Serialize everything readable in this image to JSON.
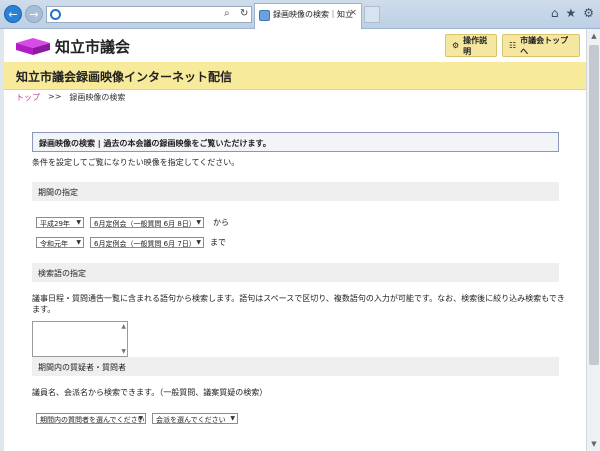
{
  "browser": {
    "tab_title": "録画映像の検索｜知立市議...",
    "tab_close": "×",
    "back_glyph": "←",
    "forward_glyph": "→",
    "address_icons": [
      "search-icon",
      "refresh-icon"
    ],
    "toolbar_icons": [
      "home-icon",
      "star-icon",
      "gear-icon"
    ]
  },
  "header": {
    "site_name": "知立市議会",
    "guide_button": "操作説明",
    "top_button": "市議会トップへ",
    "logo_color": "#c02ad0"
  },
  "banner": {
    "title": "知立市議会録画映像インターネット配信",
    "color": "#f7ea9a"
  },
  "breadcrumb": {
    "home": "トップ",
    "separator": ">>",
    "current": "録画映像の検索"
  },
  "search": {
    "heading": "録画映像の検索 | 過去の本会議の録画映像をご覧いただけます。",
    "intro": "条件を設定してご覧になりたい映像を指定してください。"
  },
  "period": {
    "title": "期間の指定",
    "from_era": "平成29年",
    "from_session": "6月定例会（一般質問 6月 8日）",
    "from_label": "から",
    "to_era": "令和元年",
    "to_session": "6月定例会（一般質問 6月 7日）",
    "to_label": "まで"
  },
  "keyword": {
    "title": "検索語の指定",
    "description": "議事日程・質問通告一覧に含まれる語句から検索します。語句はスペースで区切り、複数語句の入力が可能です。なお、検索後に絞り込み検索もできます。",
    "value": ""
  },
  "speaker": {
    "title": "期間内の質疑者・質問者",
    "description": "議員名、会派名から検索できます。（一般質問、議案質疑の検索）",
    "member_select": "期間内の質問者を選んでください",
    "faction_select": "会派を選んでください"
  }
}
